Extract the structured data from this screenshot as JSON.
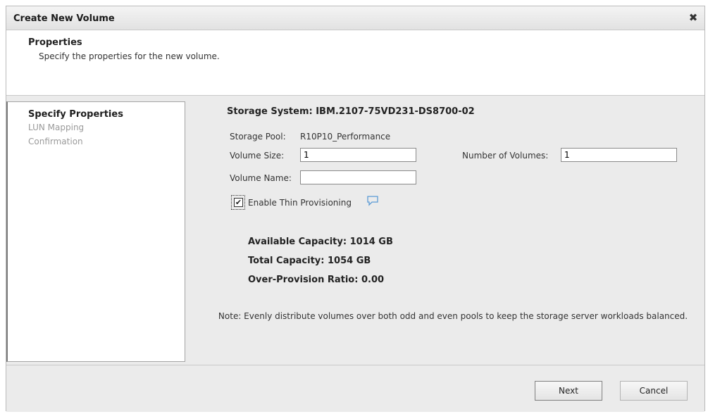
{
  "dialog": {
    "title": "Create New Volume",
    "close_glyph": "✖"
  },
  "header": {
    "title": "Properties",
    "description": "Specify the properties for the new volume."
  },
  "steps": [
    {
      "label": "Specify Properties",
      "active": true
    },
    {
      "label": "LUN Mapping",
      "active": false
    },
    {
      "label": "Confirmation",
      "active": false
    }
  ],
  "form": {
    "storage_system": "Storage System: IBM.2107-75VD231-DS8700-02",
    "storage_pool_label": "Storage Pool:",
    "storage_pool_value": "R10P10_Performance",
    "volume_size_label": "Volume Size:",
    "volume_size_value": "1",
    "number_of_volumes_label": "Number of Volumes:",
    "number_of_volumes_value": "1",
    "volume_name_label": "Volume Name:",
    "volume_name_value": "",
    "thin_provisioning_label": "Enable Thin Provisioning",
    "thin_provisioning_checked": true,
    "thin_provisioning_check_glyph": "✔",
    "help_icon": "speech-bubble-icon"
  },
  "capacity": {
    "available": "Available Capacity:  1014 GB",
    "total": "Total Capacity:  1054 GB",
    "ratio": "Over-Provision Ratio:  0.00"
  },
  "note": "Note: Evenly distribute volumes over both odd and even pools to keep the storage server workloads balanced.",
  "footer": {
    "next_label": "Next",
    "cancel_label": "Cancel"
  },
  "colors": {
    "accent_help_icon": "#5b9bd5"
  }
}
